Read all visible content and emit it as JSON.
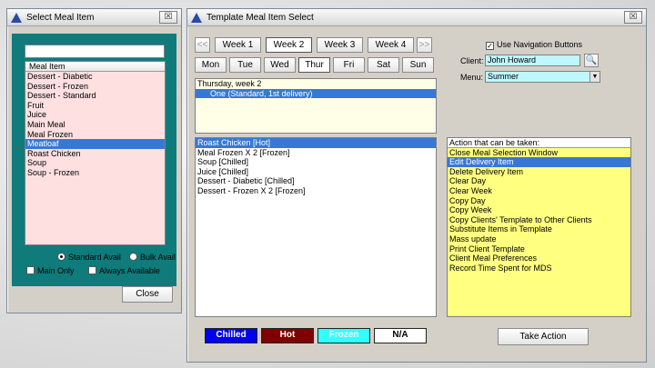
{
  "left_window": {
    "title": "Select Meal Item",
    "search_value": "",
    "list_header": "Meal Item",
    "items": [
      {
        "label": "Dessert - Diabetic"
      },
      {
        "label": "Dessert - Frozen"
      },
      {
        "label": "Dessert - Standard"
      },
      {
        "label": "Fruit"
      },
      {
        "label": "Juice"
      },
      {
        "label": "Main Meal"
      },
      {
        "label": "Meal Frozen"
      },
      {
        "label": "Meatloaf",
        "selected": true
      },
      {
        "label": "Roast Chicken"
      },
      {
        "label": "Soup"
      },
      {
        "label": "Soup - Frozen"
      }
    ],
    "standard_avail_label": "Standard Avail",
    "bulk_avail_label": "Bulk Avail",
    "main_only_label": "Main Only",
    "always_available_label": "Always Available",
    "close_label": "Close"
  },
  "right_window": {
    "title": "Template Meal Item Select",
    "prev_symbol": "<<",
    "next_symbol": ">>",
    "weeks": [
      "Week 1",
      "Week 2",
      "Week 3",
      "Week 4"
    ],
    "active_week": 1,
    "days": [
      "Mon",
      "Tue",
      "Wed",
      "Thur",
      "Fri",
      "Sat",
      "Sun"
    ],
    "active_day": 3,
    "use_nav_label": "Use Navigation Buttons",
    "use_nav_checked": "✓",
    "client_label": "Client:",
    "client_value": "John Howard",
    "menu_label": "Menu:",
    "menu_value": "Summer",
    "day_panel": {
      "heading": "Thursday, week 2",
      "delivery": "One  (Standard, 1st delivery)"
    },
    "meal_items": [
      {
        "label": "Roast Chicken  [Hot]",
        "selected": true
      },
      {
        "label": "Meal Frozen X 2  [Frozen]"
      },
      {
        "label": "Soup  [Chilled]"
      },
      {
        "label": "Juice  [Chilled]"
      },
      {
        "label": "Dessert - Diabetic  [Chilled]"
      },
      {
        "label": "Dessert - Frozen X 2  [Frozen]"
      }
    ],
    "actions_header": "Action that can be taken:",
    "actions": [
      {
        "label": "Close Meal Selection Window"
      },
      {
        "label": "Edit Delivery Item",
        "selected": true
      },
      {
        "label": "Delete Delivery Item"
      },
      {
        "label": "Clear Day"
      },
      {
        "label": "Clear Week"
      },
      {
        "label": "Copy Day"
      },
      {
        "label": "Copy Week"
      },
      {
        "label": "Copy Clients' Template to Other Clients"
      },
      {
        "label": "Substitute Items in Template"
      },
      {
        "label": "Mass update"
      },
      {
        "label": "Print Client Template"
      },
      {
        "label": "Client Meal Preferences"
      },
      {
        "label": "Record Time Spent for MDS"
      }
    ],
    "legend": [
      {
        "label": "Chilled",
        "bg": "#0000ee",
        "fg": "#ffffff"
      },
      {
        "label": "Hot",
        "bg": "#800000",
        "fg": "#ffffff"
      },
      {
        "label": "Frozen",
        "bg": "#33ffff",
        "fg": "#ffffff"
      },
      {
        "label": "N/A",
        "bg": "#ffffff",
        "fg": "#000000"
      }
    ],
    "take_action_label": "Take Action"
  },
  "colors": {
    "pink_list": "#ffe0e0",
    "yellow_list": "#ffff80",
    "cream_panel": "#ffffe8",
    "teal_frame": "#0f7b7b",
    "selection": "#3778d4",
    "client_field": "#bff7ff"
  }
}
